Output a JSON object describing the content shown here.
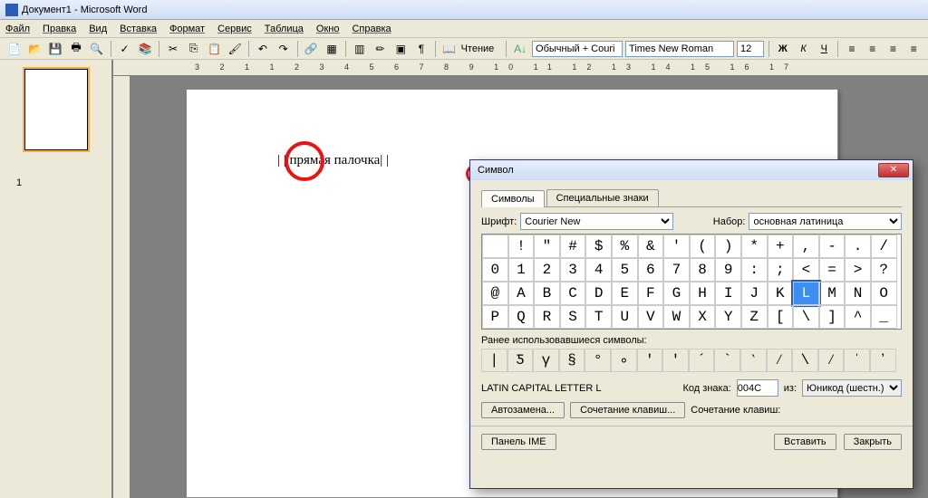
{
  "title": "Документ1 - Microsoft Word",
  "menu": {
    "file": "Файл",
    "edit": "Правка",
    "view": "Вид",
    "insert": "Вставка",
    "format": "Формат",
    "tools": "Сервис",
    "table": "Таблица",
    "window": "Окно",
    "help": "Справка"
  },
  "toolbar": {
    "reading": "Чтение",
    "style_label": "Обычный + Couri",
    "font": "Times New Roman",
    "size": "12"
  },
  "thumbnail": {
    "page_num": "1"
  },
  "hruler_ticks": "3 2 1 1 2 3 4 5 6 7 8 9 10 11 12 13 14 15 16 17",
  "doc": {
    "text": "| | прямая палочка|   |"
  },
  "dialog": {
    "title": "Символ",
    "tabs": {
      "symbols": "Символы",
      "special": "Специальные знаки"
    },
    "font_label": "Шрифт:",
    "font": "Courier New",
    "set_label": "Набор:",
    "set": "основная латиница",
    "grid": [
      [
        " ",
        "!",
        "\"",
        "#",
        "$",
        "%",
        "&",
        "'",
        "(",
        ")",
        "*",
        "+",
        ",",
        "-",
        ".",
        "/"
      ],
      [
        "0",
        "1",
        "2",
        "3",
        "4",
        "5",
        "6",
        "7",
        "8",
        "9",
        ":",
        ";",
        "<",
        "=",
        ">",
        "?"
      ],
      [
        "@",
        "A",
        "B",
        "C",
        "D",
        "E",
        "F",
        "G",
        "H",
        "I",
        "J",
        "K",
        "L",
        "M",
        "N",
        "O"
      ],
      [
        "P",
        "Q",
        "R",
        "S",
        "T",
        "U",
        "V",
        "W",
        "X",
        "Y",
        "Z",
        "[",
        "\\",
        "]",
        "^",
        "_"
      ]
    ],
    "selected": "L",
    "recent_label": "Ранее использовавшиеся символы:",
    "recent": [
      "|",
      "Ƽ",
      "γ",
      "§",
      "°",
      "∘",
      "ʹ",
      "ʹ",
      "´",
      "`",
      "‵",
      "⁄",
      "\\",
      "⁄",
      "ˈ",
      "ʼ"
    ],
    "char_name": "LATIN CAPITAL LETTER L",
    "code_label": "Код знака:",
    "code": "004C",
    "from_label": "из:",
    "from": "Юникод (шестн.)",
    "autocorrect": "Автозамена...",
    "shortcut_btn": "Сочетание клавиш...",
    "shortcut_label": "Сочетание клавиш:",
    "ime": "Панель IME",
    "insert": "Вставить",
    "close": "Закрыть"
  }
}
